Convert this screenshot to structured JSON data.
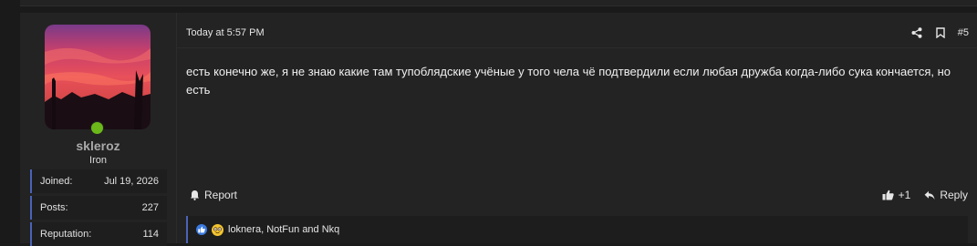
{
  "user": {
    "username": "skleroz",
    "title": "Iron",
    "online": true,
    "stats": [
      {
        "label": "Joined:",
        "value": "Jul 19, 2026"
      },
      {
        "label": "Posts:",
        "value": "227"
      },
      {
        "label": "Reputation:",
        "value": "114"
      }
    ]
  },
  "post": {
    "date": "Today at 5:57 PM",
    "number": "#5",
    "message": "есть конечно же, я не знаю какие там тупоблядские учёные у того чела чё подтвердили если любая дружба когда-либо сука кончается, но есть",
    "report_label": "Report",
    "reaction_count": "+1",
    "reply_label": "Reply",
    "reactions_text": "loknera, NotFun and Nkq"
  },
  "colors": {
    "accent": "#4a63b8",
    "online": "#6cb81a",
    "background": "#1a1a1a",
    "panel": "#232323"
  },
  "icons": [
    "share-icon",
    "bookmark-icon",
    "report-bell-icon",
    "like-icon",
    "reply-arrow-icon",
    "like-reaction-icon",
    "nerd-emoji-icon"
  ]
}
